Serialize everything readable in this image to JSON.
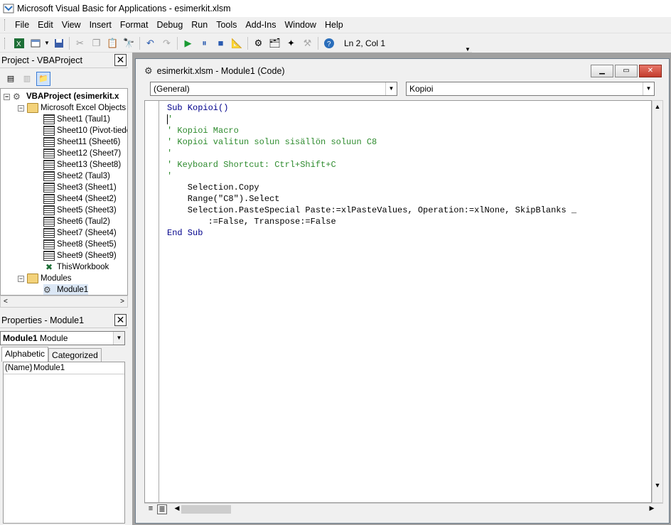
{
  "window": {
    "title": "Microsoft Visual Basic for Applications - esimerkit.xlsm"
  },
  "menu": [
    "File",
    "Edit",
    "View",
    "Insert",
    "Format",
    "Debug",
    "Run",
    "Tools",
    "Add-Ins",
    "Window",
    "Help"
  ],
  "toolbar": {
    "position": "Ln 2, Col 1"
  },
  "project": {
    "title": "Project - VBAProject",
    "root": "VBAProject (esimerkit.x",
    "excel_objects": "Microsoft Excel Objects",
    "sheets": [
      "Sheet1 (Taul1)",
      "Sheet10 (Pivot-tiedo",
      "Sheet11 (Sheet6)",
      "Sheet12 (Sheet7)",
      "Sheet13 (Sheet8)",
      "Sheet2 (Taul3)",
      "Sheet3 (Sheet1)",
      "Sheet4 (Sheet2)",
      "Sheet5 (Sheet3)",
      "Sheet6 (Taul2)",
      "Sheet7 (Sheet4)",
      "Sheet8 (Sheet5)",
      "Sheet9 (Sheet9)"
    ],
    "workbook": "ThisWorkbook",
    "modules_folder": "Modules",
    "module": "Module1"
  },
  "properties": {
    "title": "Properties - Module1",
    "object_name": "Module1",
    "object_type": "Module",
    "tab_alpha": "Alphabetic",
    "tab_cat": "Categorized",
    "row_key": "(Name)",
    "row_value": "Module1"
  },
  "code_window": {
    "title": "esimerkit.xlsm - Module1 (Code)",
    "object_combo": "(General)",
    "proc_combo": "Kopioi",
    "lines": [
      {
        "t": "Sub Kopioi()",
        "c": "kw"
      },
      {
        "t": "'",
        "c": "cm"
      },
      {
        "t": "' Kopioi Macro",
        "c": "cm"
      },
      {
        "t": "' Kopioi valitun solun sisällön soluun C8",
        "c": "cm"
      },
      {
        "t": "'",
        "c": "cm"
      },
      {
        "t": "' Keyboard Shortcut: Ctrl+Shift+C",
        "c": "cm"
      },
      {
        "t": "'",
        "c": "cm"
      },
      {
        "t": "    Selection.Copy",
        "c": ""
      },
      {
        "t": "    Range(\"C8\").Select",
        "c": ""
      },
      {
        "t": "    Selection.PasteSpecial Paste:=xlPasteValues, Operation:=xlNone, SkipBlanks _",
        "c": ""
      },
      {
        "t": "        :=False, Transpose:=False",
        "c": ""
      },
      {
        "t": "End Sub",
        "c": "kw"
      }
    ]
  }
}
